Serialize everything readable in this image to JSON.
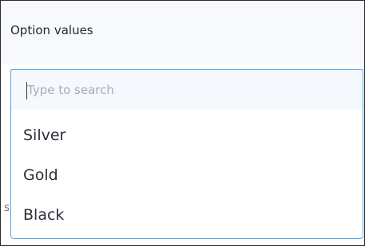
{
  "field": {
    "label": "Option values"
  },
  "search": {
    "placeholder": "Type to search",
    "value": ""
  },
  "options": [
    {
      "label": "Silver"
    },
    {
      "label": "Gold"
    },
    {
      "label": "Black"
    }
  ],
  "colors": {
    "accent_border": "#5aa4e8",
    "header_bg": "#f7f9fc",
    "input_bg": "#f5f8fc",
    "placeholder": "#a7aeb6",
    "text": "#2a3039"
  }
}
